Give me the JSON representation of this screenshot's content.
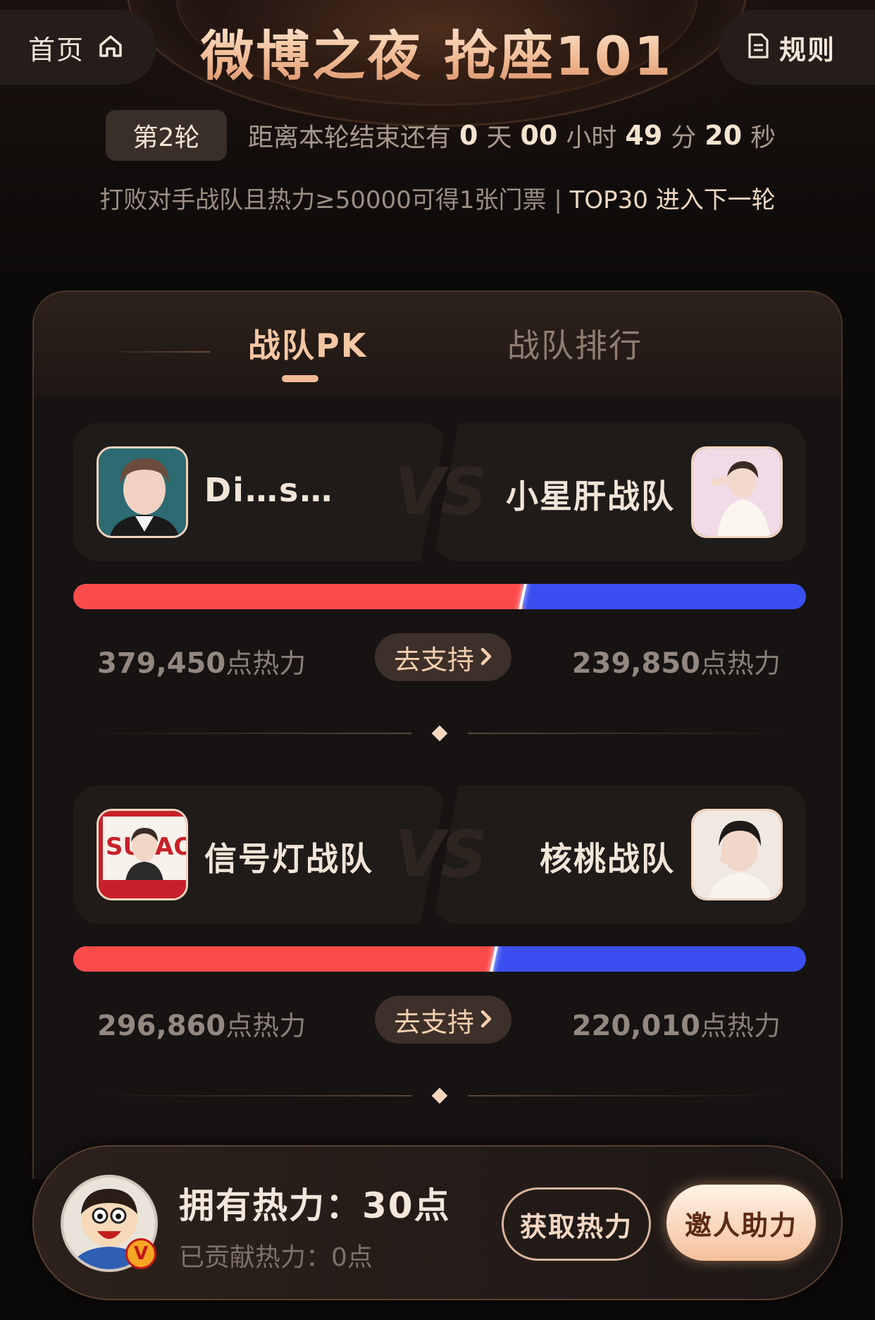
{
  "header": {
    "home_label": "首页",
    "rules_label": "规则",
    "title": "微博之夜 抢座101"
  },
  "round": {
    "badge": "第2轮",
    "countdown_prefix": "距离本轮结束还有",
    "days": "0",
    "days_unit": "天",
    "hours": "00",
    "hours_unit": "小时",
    "minutes": "49",
    "minutes_unit": "分",
    "seconds": "20",
    "seconds_unit": "秒"
  },
  "rule_text": {
    "main": "打败对手战队且热力≥50000可得1张门票 | ",
    "highlight": "TOP30 进入下一轮"
  },
  "tabs": [
    {
      "label": "战队PK",
      "active": true
    },
    {
      "label": "战队排行",
      "active": false
    }
  ],
  "matches": [
    {
      "left": {
        "name": "Di…s…",
        "score": "379,450",
        "score_unit": "点热力"
      },
      "right": {
        "name": "小星肝战队",
        "score": "239,850",
        "score_unit": "点热力"
      },
      "vs": "VS",
      "support_label": "去支持",
      "left_share": 0.613
    },
    {
      "left": {
        "name": "信号灯战队",
        "score": "296,860",
        "score_unit": "点热力"
      },
      "right": {
        "name": "核桃战队",
        "score": "220,010",
        "score_unit": "点热力"
      },
      "vs": "VS",
      "support_label": "去支持",
      "left_share": 0.574
    }
  ],
  "footer": {
    "owned_label": "拥有热力：",
    "owned_value": "30点",
    "contributed": "已贡献热力：0点",
    "get_button": "获取热力",
    "invite_button": "邀人助力"
  },
  "colors": {
    "red": "#fb4a4a",
    "blue": "#3b4ff0",
    "accent": "#f2b896"
  },
  "icons": [
    "home-icon",
    "document-icon",
    "chevron-right-icon",
    "verified-v-icon"
  ]
}
